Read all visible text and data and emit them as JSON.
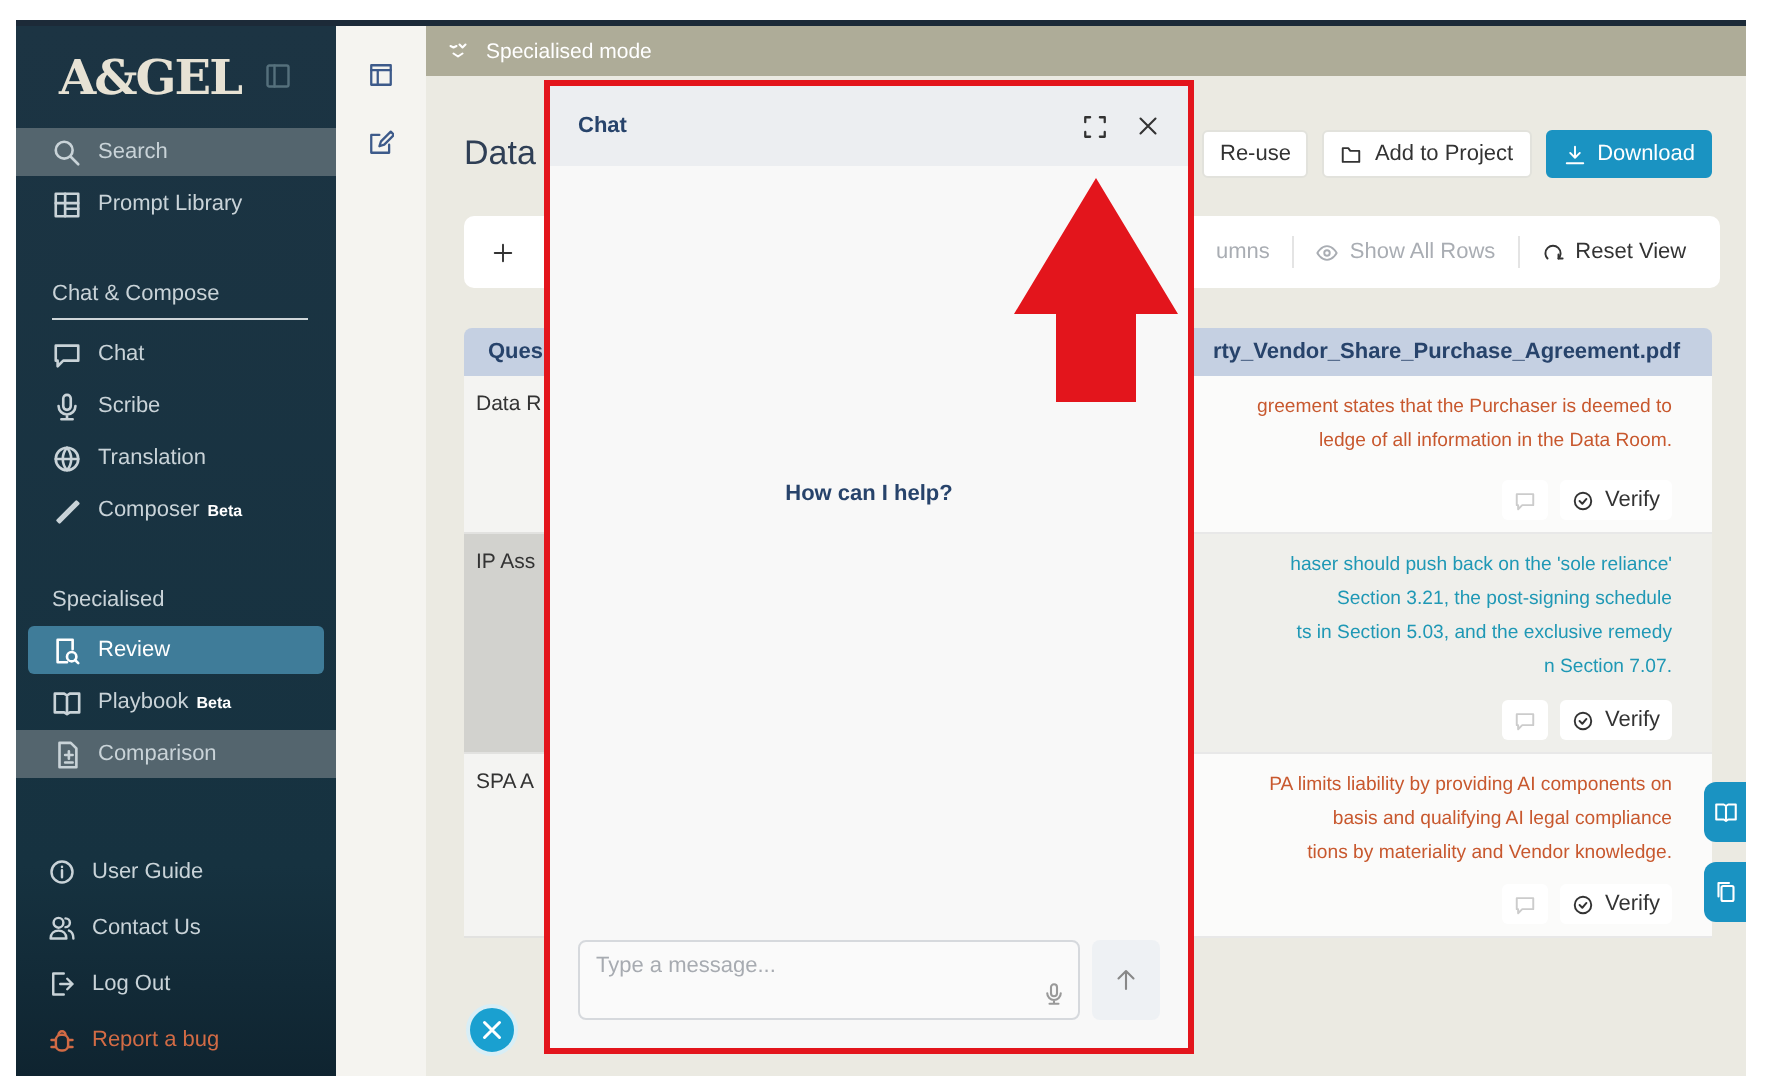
{
  "sidebar": {
    "logo": "A&GEL",
    "top_items": [
      {
        "label": "Search",
        "highlighted": true,
        "selected": false
      },
      {
        "label": "Prompt Library",
        "highlighted": false,
        "selected": false
      }
    ],
    "sections": [
      {
        "title": "Chat & Compose",
        "items": [
          {
            "label": "Chat",
            "highlighted": false,
            "selected": false
          },
          {
            "label": "Scribe",
            "highlighted": false,
            "selected": false
          },
          {
            "label": "Translation",
            "highlighted": false,
            "selected": false
          },
          {
            "label": "Composer",
            "badge": "Beta",
            "highlighted": false,
            "selected": false
          }
        ]
      },
      {
        "title": "Specialised",
        "items": [
          {
            "label": "Review",
            "highlighted": false,
            "selected": true
          },
          {
            "label": "Playbook",
            "badge": "Beta",
            "highlighted": false,
            "selected": false
          },
          {
            "label": "Comparison",
            "highlighted": true,
            "selected": false
          }
        ]
      }
    ],
    "bottom_items": [
      {
        "label": "User Guide",
        "kind": "plain"
      },
      {
        "label": "Contact Us",
        "kind": "plain"
      },
      {
        "label": "Log Out",
        "kind": "plain"
      },
      {
        "label": "Report a bug",
        "kind": "alert"
      }
    ]
  },
  "mode_bar": {
    "label": "Specialised mode"
  },
  "header": {
    "title": "Data",
    "buttons": [
      {
        "label": "Re-use",
        "kind": "plain"
      },
      {
        "label": "Add to Project",
        "kind": "plain"
      },
      {
        "label": "Download",
        "kind": "primary"
      }
    ]
  },
  "toolbar": [
    {
      "label": "umns",
      "disabled": true
    },
    {
      "label": "Show All Rows",
      "disabled": true
    },
    {
      "label": "Reset View",
      "disabled": false
    }
  ],
  "table": {
    "columns": [
      "Ques",
      "rty_Vendor_Share_Purchase_Agreement.pdf"
    ],
    "rows": [
      {
        "question": "Data R",
        "answer_lines": [
          "greement states that the Purchaser is deemed to",
          "ledge of all information in the Data Room."
        ],
        "color": "#c8582e",
        "highlighted": false,
        "verify": "Verify"
      },
      {
        "question": "IP Ass",
        "answer_lines": [
          "haser should push back on the 'sole reliance'",
          "Section 3.21, the post-signing schedule",
          "ts in Section 5.03, and the exclusive remedy",
          "n Section 7.07."
        ],
        "color": "#1f98b5",
        "highlighted": true,
        "verify": "Verify"
      },
      {
        "question": "SPA A",
        "answer_lines": [
          "PA limits liability by providing AI components on",
          "basis and qualifying AI legal compliance",
          "tions by materiality and Vendor knowledge."
        ],
        "color": "#c8582e",
        "highlighted": false,
        "verify": "Verify"
      }
    ]
  },
  "chat": {
    "title": "Chat",
    "greeting": "How can I help?",
    "input": {
      "placeholder": "Type a message..."
    },
    "send": {
      "disabled": true
    }
  }
}
